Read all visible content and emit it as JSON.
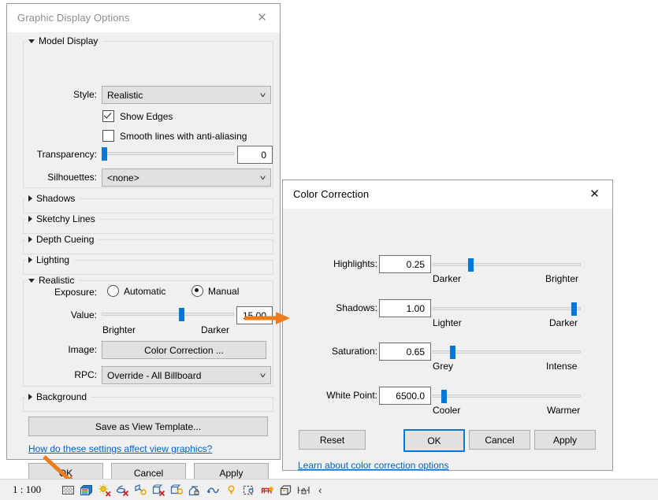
{
  "graphic_display_options": {
    "title": "Graphic Display Options",
    "close_label": "✕",
    "sections": [
      {
        "name": "Model Display",
        "expanded": true
      },
      {
        "name": "Shadows",
        "expanded": false
      },
      {
        "name": "Sketchy Lines",
        "expanded": false
      },
      {
        "name": "Depth Cueing",
        "expanded": false
      },
      {
        "name": "Lighting",
        "expanded": false
      },
      {
        "name": "Realistic",
        "expanded": true
      },
      {
        "name": "Background",
        "expanded": false
      }
    ],
    "model_display": {
      "style_label": "Style:",
      "style_value": "Realistic",
      "show_edges_label": "Show Edges",
      "show_edges_checked": true,
      "smooth_lines_label": "Smooth lines with anti-aliasing",
      "smooth_lines_checked": false,
      "transparency_label": "Transparency:",
      "transparency_value": "0",
      "transparency_percent": 0,
      "silhouettes_label": "Silhouettes:",
      "silhouettes_value": "<none>"
    },
    "realistic": {
      "exposure_label": "Exposure:",
      "automatic_label": "Automatic",
      "manual_label": "Manual",
      "exposure_selected": "Manual",
      "value_label": "Value:",
      "value_value": "15.00",
      "value_percent": 61,
      "value_min_label": "Brighter",
      "value_max_label": "Darker",
      "image_label": "Image:",
      "color_correction_button": "Color Correction ...",
      "rpc_label": "RPC:",
      "rpc_value": "Override - All Billboard"
    },
    "save_template_button": "Save as View Template...",
    "help_link": "How do these settings affect view graphics?",
    "buttons": {
      "ok": "OK",
      "cancel": "Cancel",
      "apply": "Apply"
    }
  },
  "color_correction": {
    "title": "Color Correction",
    "close_label": "✕",
    "rows": [
      {
        "label": "Highlights:",
        "value": "0.25",
        "percent": 25,
        "min_label": "Darker",
        "max_label": "Brighter"
      },
      {
        "label": "Shadows:",
        "value": "1.00",
        "percent": 97,
        "min_label": "Lighter",
        "max_label": "Darker"
      },
      {
        "label": "Saturation:",
        "value": "0.65",
        "percent": 12,
        "min_label": "Grey",
        "max_label": "Intense"
      },
      {
        "label": "White Point:",
        "value": "6500.0",
        "percent": 6,
        "min_label": "Cooler",
        "max_label": "Warmer"
      }
    ],
    "buttons": {
      "reset": "Reset",
      "ok": "OK",
      "cancel": "Cancel",
      "apply": "Apply"
    },
    "default_button": "OK",
    "help_link": "Learn about color correction options"
  },
  "status_bar": {
    "scale": "1 : 100",
    "icons": [
      "hidden-line-pattern-icon",
      "visual-style-cube-icon",
      "sun-path-off-icon",
      "shadows-off-icon",
      "rendering-light-icon",
      "sketchy-lines-off-icon",
      "render-display-icon",
      "crop-region-lock-icon",
      "temporary-hide-isolate-icon",
      "reveal-hidden-elements-icon",
      "crop-view-icon",
      "analytical-model-icon",
      "geometry-box-icon",
      "constraints-icon"
    ],
    "more_label": "‹"
  },
  "annotations": {
    "accent_color": "#ED7D1B",
    "arrow_to_color_correction": "arrow pointing right from Color Correction button",
    "arrow_to_visual_style_icon": "arrow pointing down-right to visual style icon"
  },
  "theme": {
    "dialog_bg": "#f0f0f0",
    "titlebar_bg": "#ffffff",
    "accent_blue": "#0078d7",
    "link_blue": "#0563c1",
    "button_bg": "#e1e1e1",
    "button_border": "#adadad"
  }
}
